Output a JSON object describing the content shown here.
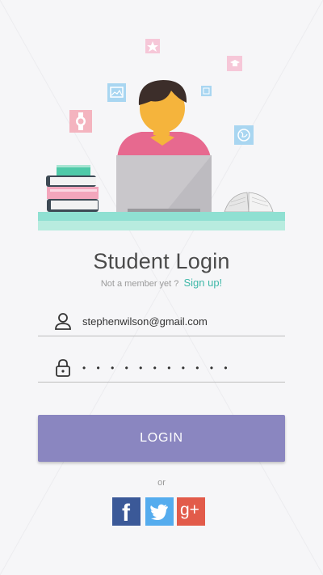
{
  "login": {
    "title": "Student Login",
    "prompt": "Not a member yet ?",
    "signup_link": "Sign up!",
    "email_value": "stephenwilson@gmail.com",
    "password_mask": "• • • • • • • • • • •",
    "button_label": "LOGIN",
    "or_text": "or"
  },
  "social": {
    "facebook_glyph": "f",
    "twitter_glyph": "twitter-bird",
    "googleplus_glyph": "g+"
  },
  "colors": {
    "background": "#f6f6f8",
    "accent_teal": "#3fb8a8",
    "button": "#8a86c0",
    "facebook": "#3b5998",
    "twitter": "#55acee",
    "googleplus": "#e25b4a"
  },
  "icons": [
    "person-icon",
    "lock-icon",
    "watch-icon",
    "image-icon",
    "star-icon",
    "graduation-cap-icon",
    "globe-icon",
    "books-icon",
    "laptop-icon",
    "open-book-icon"
  ]
}
